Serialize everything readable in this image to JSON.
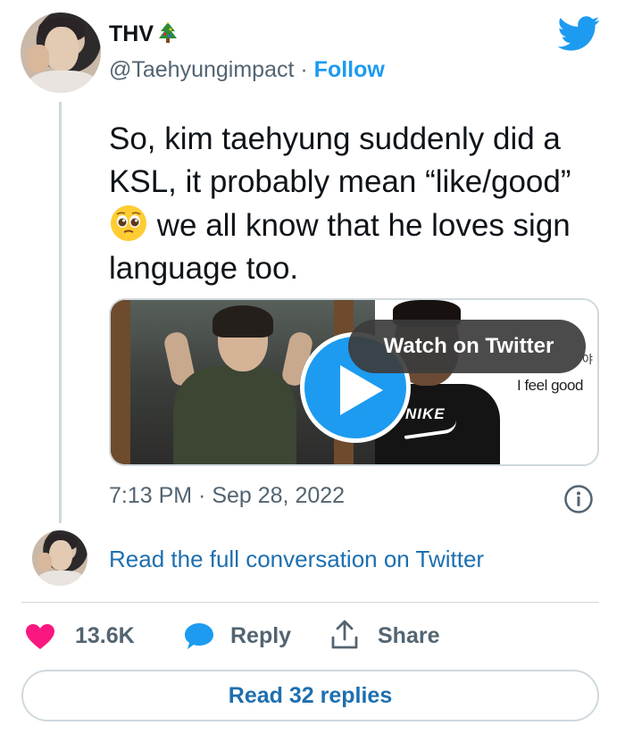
{
  "author": {
    "name": "THV",
    "name_emoji": "christmas-tree-icon",
    "handle": "@Taehyungimpact",
    "separator": "·",
    "follow_label": "Follow"
  },
  "tweet": {
    "text": "So, kim taehyung suddenly did a KSL, it probably mean “like/good”",
    "emoji": "pleading-face-icon",
    "text_after": "we all know that he loves sign language too.",
    "timestamp": "7:13 PM · Sep 28, 2022"
  },
  "media": {
    "watch_label": "Watch on Twitter",
    "caption_top": "야",
    "caption": "I feel good",
    "shirt_brand": "NIKE"
  },
  "conversation": {
    "link_label": "Read the full conversation on Twitter"
  },
  "actions": {
    "likes": "13.6K",
    "reply_label": "Reply",
    "share_label": "Share"
  },
  "footer": {
    "read_replies_label": "Read 32 replies"
  },
  "colors": {
    "accent": "#1d9bf0",
    "link": "#1d6fb0",
    "heart": "#f91880",
    "muted": "#536471"
  }
}
